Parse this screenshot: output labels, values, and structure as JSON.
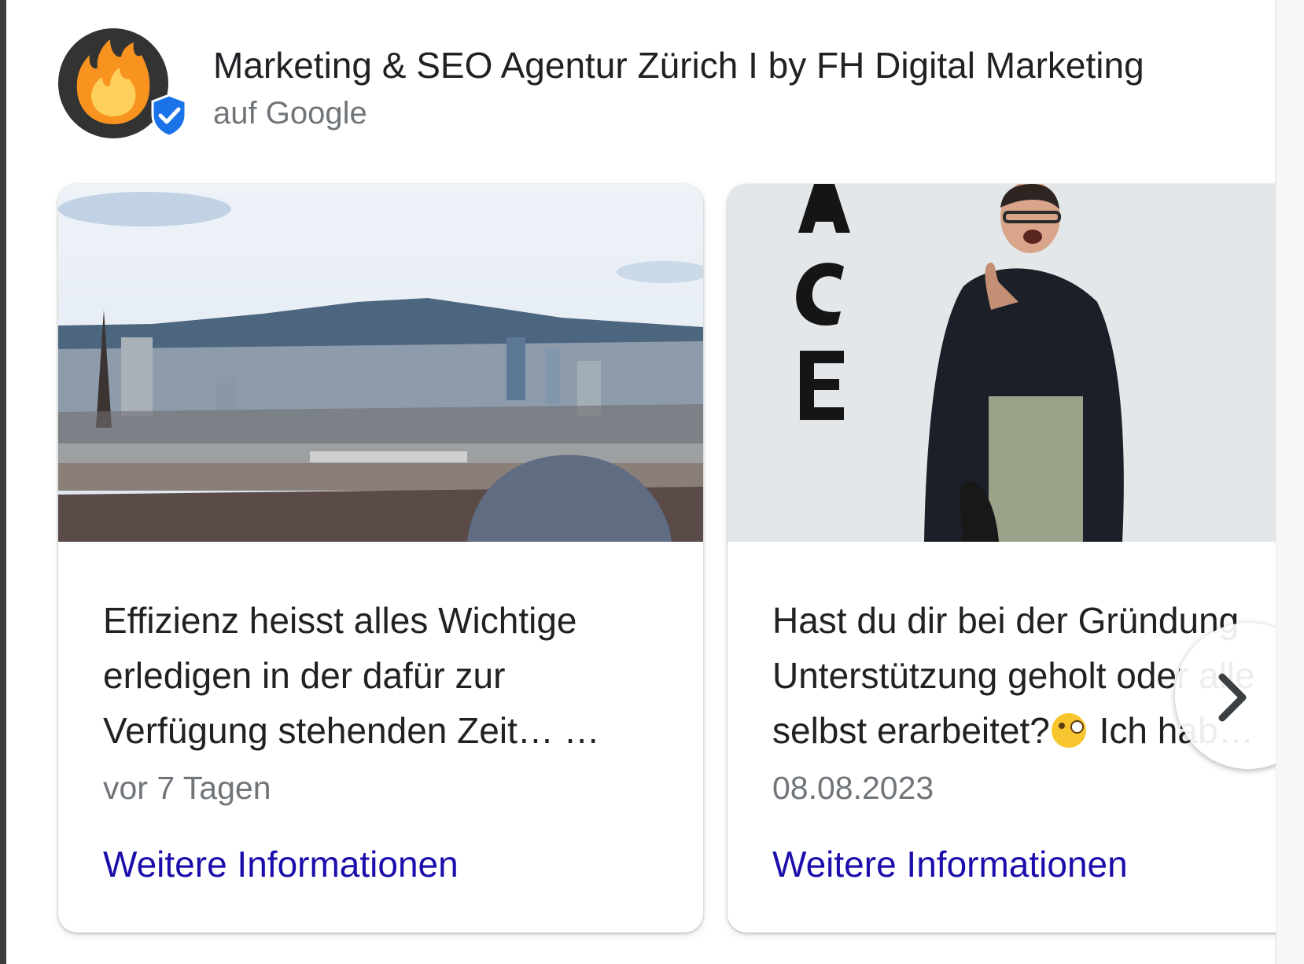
{
  "business": {
    "name": "Marketing & SEO Agentur Zürich I by FH Digital Marketing",
    "subtitle": "auf Google",
    "verified": true,
    "logo_icon": "flame-icon",
    "badge_icon": "verified-check-icon"
  },
  "colors": {
    "link": "#1a0dab",
    "text": "#202124",
    "secondary": "#70757a",
    "badge": "#1a73e8",
    "flame": "#f39c12"
  },
  "posts": [
    {
      "image": "Zürich city skyline panorama with mountains and a knit beanie in foreground",
      "text_lines": [
        "Effizienz heisst alles Wichtige",
        "erledigen in der dafür zur",
        "Verfügung stehenden Zeit… …"
      ],
      "date": "vor 7 Tagen",
      "link": "Weitere Informationen"
    },
    {
      "image": "Smiling man in dark jacket pointing at letters A C E on a white wall",
      "text_lines": [
        "Hast du dir bei der Gründung",
        "Unterstützung geholt oder alle",
        "selbst erarbeitet?",
        " Ich hab…"
      ],
      "emoji": "face-with-monocle-emoji",
      "date": "08.08.2023",
      "link": "Weitere Informationen"
    }
  ],
  "carousel": {
    "next_icon": "chevron-right-icon"
  }
}
